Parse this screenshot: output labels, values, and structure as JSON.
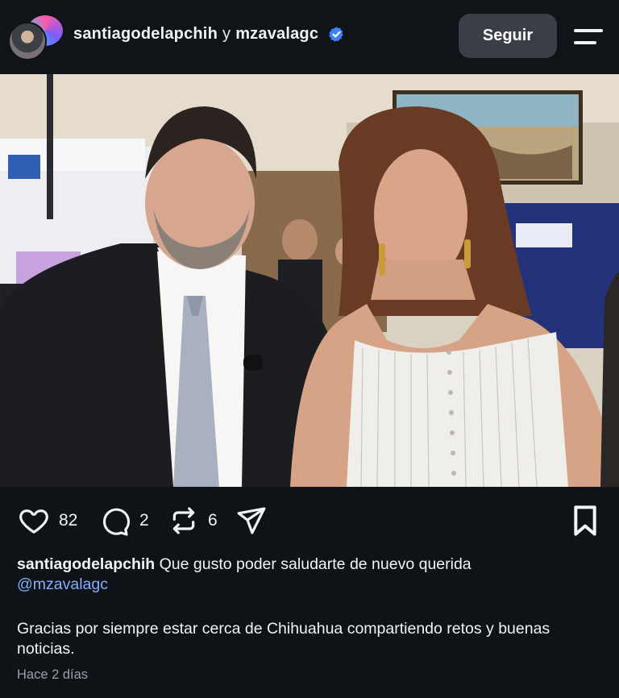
{
  "header": {
    "user1": "santiagodelapchih",
    "conjunction": "y",
    "user2": "mzavalagc",
    "follow_label": "Seguir"
  },
  "icons": {
    "verified": "verified-badge-icon",
    "menu": "menu-icon",
    "like": "heart-icon",
    "comment": "comment-icon",
    "repost": "repost-icon",
    "share": "send-icon",
    "save": "bookmark-icon"
  },
  "actions": {
    "likes": "82",
    "comments": "2",
    "reposts": "6"
  },
  "caption": {
    "user": "santiagodelapchih",
    "text": "Que gusto poder saludarte de nuevo querida",
    "mention": "@mzavalagc",
    "text2": "Gracias por siempre estar cerca de Chihuahua compartiendo retos y buenas noticias."
  },
  "timestamp": "Hace 2 días",
  "colors": {
    "background": "#0f1216",
    "follow_button": "#3a3f47",
    "verified": "#3b82f6",
    "mention": "#7fb0ff",
    "muted": "#9aa0a8"
  }
}
